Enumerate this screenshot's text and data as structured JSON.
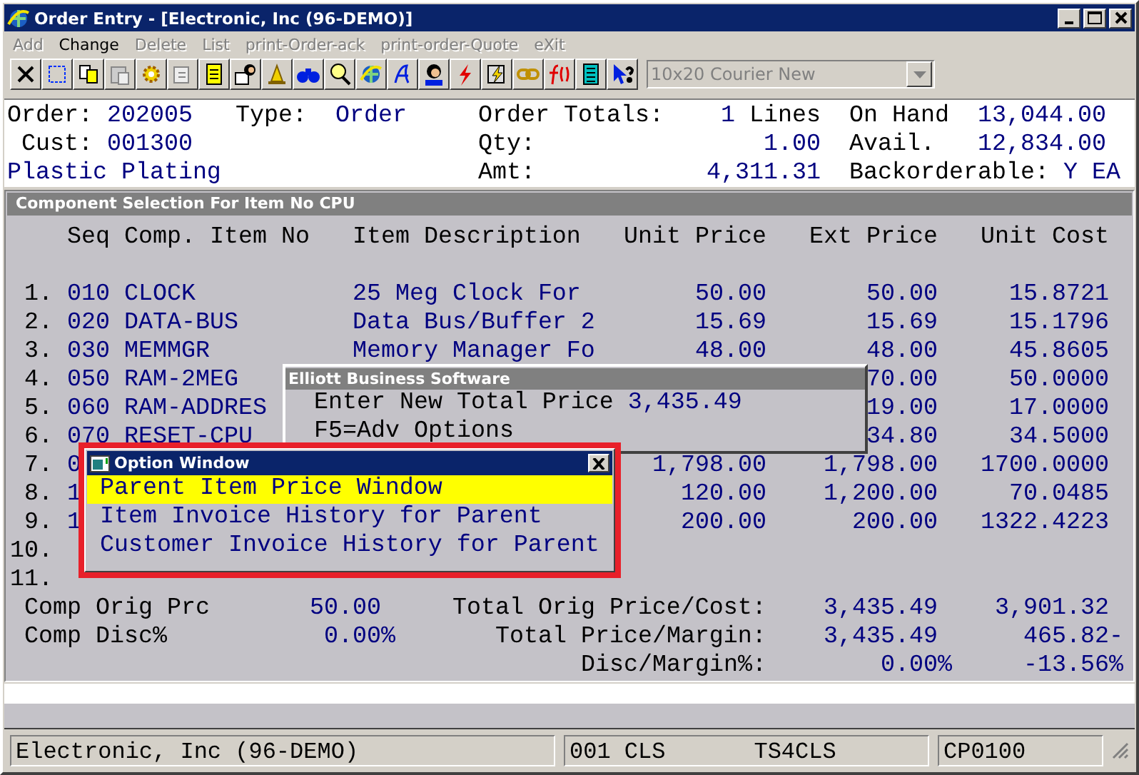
{
  "window": {
    "title": "Order Entry - [Electronic, Inc (96-DEMO)]"
  },
  "menu": [
    {
      "label": "Add",
      "disabled": true
    },
    {
      "label": "Change",
      "disabled": false
    },
    {
      "label": "Delete",
      "disabled": true
    },
    {
      "label": "List",
      "disabled": true
    },
    {
      "label": "print-Order-ack",
      "disabled": true
    },
    {
      "label": "print-order-Quote",
      "disabled": true
    },
    {
      "label": "eXit",
      "disabled": true
    }
  ],
  "font_select": {
    "value": "10x20 Courier New",
    "disabled": true
  },
  "header": [
    [
      {
        "text": "Order:",
        "kind": "label"
      },
      {
        "text": "202005",
        "kind": "value"
      },
      {
        "text": "Type:",
        "kind": "label"
      },
      {
        "text": "Order",
        "kind": "value"
      },
      {
        "text": "Order Totals:",
        "kind": "label"
      },
      {
        "text": "1",
        "kind": "value"
      },
      {
        "text": "Lines",
        "kind": "label"
      },
      {
        "text": "On Hand",
        "kind": "label"
      },
      {
        "text": "13,044.00",
        "kind": "value"
      }
    ],
    [
      {
        "text": "Cust:",
        "kind": "label"
      },
      {
        "text": "001300",
        "kind": "value"
      },
      {
        "text": "Qty:",
        "kind": "label"
      },
      {
        "text": "1.00",
        "kind": "value"
      },
      {
        "text": "Avail.",
        "kind": "label"
      },
      {
        "text": "12,834.00",
        "kind": "value"
      }
    ],
    [
      {
        "text": "Plastic Plating",
        "kind": "value"
      },
      {
        "text": "Amt:",
        "kind": "label"
      },
      {
        "text": "4,311.31",
        "kind": "value"
      },
      {
        "text": "Backorderable:",
        "kind": "label"
      },
      {
        "text": "Y EA",
        "kind": "value"
      }
    ]
  ],
  "panel": {
    "title": "Component Selection For Item No CPU",
    "columns": [
      "Seq",
      "Comp. Item No",
      "Item Description",
      "Unit Price",
      "Ext Price",
      "Unit Cost"
    ],
    "rows": [
      {
        "line": "1.",
        "seq": "010",
        "item_no": "CLOCK",
        "description": "25 Meg Clock For",
        "unit_price": "50.00",
        "ext_price": "50.00",
        "unit_cost": "15.8721"
      },
      {
        "line": "2.",
        "seq": "020",
        "item_no": "DATA-BUS",
        "description": "Data Bus/Buffer 2",
        "unit_price": "15.69",
        "ext_price": "15.69",
        "unit_cost": "15.1796"
      },
      {
        "line": "3.",
        "seq": "030",
        "item_no": "MEMMGR",
        "description": "Memory Manager Fo",
        "unit_price": "48.00",
        "ext_price": "48.00",
        "unit_cost": "45.8605"
      },
      {
        "line": "4.",
        "seq": "050",
        "item_no": "RAM-2MEG",
        "ext_price": "70.00",
        "unit_cost": "50.0000"
      },
      {
        "line": "5.",
        "seq": "060",
        "item_no": "RAM-ADDRES",
        "ext_price": "19.00",
        "unit_cost": "17.0000"
      },
      {
        "line": "6.",
        "seq": "070",
        "item_no": "RESET-CPU",
        "ext_price": "34.80",
        "unit_cost": "34.5000"
      },
      {
        "line": "7.",
        "seq": "0",
        "unit_price": "1,798.00",
        "ext_price": "1,798.00",
        "unit_cost": "1700.0000"
      },
      {
        "line": "8.",
        "seq": "1",
        "unit_price": "120.00",
        "ext_price": "1,200.00",
        "unit_cost": "70.0485"
      },
      {
        "line": "9.",
        "seq": "1",
        "unit_price": "200.00",
        "ext_price": "200.00",
        "unit_cost": "1322.4223"
      },
      {
        "line": "10."
      },
      {
        "line": "11."
      }
    ],
    "summary": [
      [
        {
          "text": "Comp Orig Prc",
          "kind": "label"
        },
        {
          "text": "50.00",
          "kind": "value"
        },
        {
          "text": "Total Orig Price/Cost:",
          "kind": "label"
        },
        {
          "text": "3,435.49",
          "kind": "value"
        },
        {
          "text": "3,901.32",
          "kind": "value"
        }
      ],
      [
        {
          "text": "Comp Disc%",
          "kind": "label"
        },
        {
          "text": "0.00%",
          "kind": "value"
        },
        {
          "text": "Total Price/Margin:",
          "kind": "label"
        },
        {
          "text": "3,435.49",
          "kind": "value"
        },
        {
          "text": "465.82-",
          "kind": "value"
        }
      ],
      [
        {
          "text": "Disc/Margin%:",
          "kind": "label"
        },
        {
          "text": "0.00%",
          "kind": "value"
        },
        {
          "text": "-13.56%",
          "kind": "value"
        }
      ]
    ]
  },
  "price_dialog": {
    "title": "Elliott Business Software",
    "prompt": "Enter New Total Price",
    "value": "3,435.49",
    "hint": "F5=Adv Options"
  },
  "option_window": {
    "title": "Option Window",
    "items": [
      {
        "label": "Parent Item Price Window",
        "selected": true
      },
      {
        "label": "Item Invoice History for Parent",
        "selected": false
      },
      {
        "label": "Customer Invoice History for Parent",
        "selected": false
      }
    ]
  },
  "status_bar": {
    "company": "Electronic, Inc (96-DEMO)",
    "user": "001 CLS",
    "terminal": "TS4CLS",
    "program": "CP0100"
  }
}
